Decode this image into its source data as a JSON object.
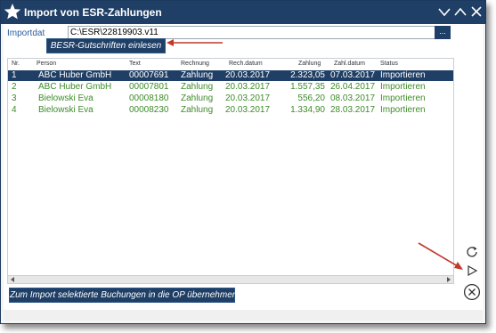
{
  "window": {
    "title": "Import von ESR-Zahlungen"
  },
  "import": {
    "label": "Importdat",
    "path": "C:\\ESR\\22819903.v11",
    "browse_label": "..."
  },
  "buttons": {
    "read_label": "BESR-Gutschriften einlesen",
    "import_label": "Zum Import selektierte Buchungen in die OP übernehmen"
  },
  "table": {
    "headers": [
      "Nr.",
      "Person",
      "Text",
      "Rechnung",
      "Rech.datum",
      "Zahlung",
      "Zahl.datum",
      "Status"
    ],
    "rows": [
      [
        "1",
        "ABC Huber GmbH",
        "00007691",
        "Zahlung",
        "20.03.2017",
        "2.323,05",
        "07.03.2017",
        "Importieren"
      ],
      [
        "2",
        "ABC Huber GmbH",
        "00007801",
        "Zahlung",
        "20.03.2017",
        "1.557,35",
        "26.04.2017",
        "Importieren"
      ],
      [
        "3",
        "Bielowski Eva",
        "00008180",
        "Zahlung",
        "20.03.2017",
        "556,20",
        "08.03.2017",
        "Importieren"
      ],
      [
        "4",
        "Bielowski Eva",
        "00008230",
        "Zahlung",
        "20.03.2017",
        "1.334,90",
        "28.03.2017",
        "Importieren"
      ]
    ]
  },
  "colors": {
    "accent": "#1f3f66",
    "row_text": "#3d8c2a",
    "annotation_arrow": "#c0392b"
  },
  "icons": [
    "star-icon",
    "chevron-down-icon",
    "chevron-up-icon",
    "close-icon",
    "refresh-icon",
    "play-icon",
    "cancel-icon",
    "browse-icon"
  ]
}
